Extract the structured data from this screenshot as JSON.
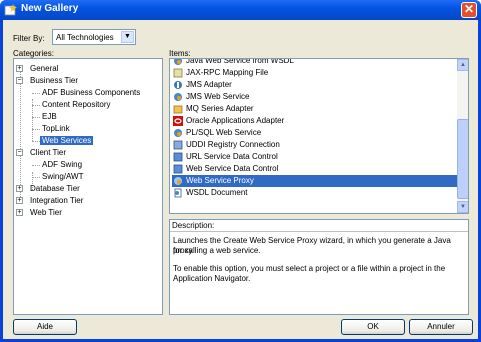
{
  "window": {
    "title": "New Gallery",
    "close_glyph": "✕"
  },
  "filter": {
    "label": "Filter By:",
    "value": "All Technologies"
  },
  "categories": {
    "label": "Categories:",
    "nodes": [
      {
        "label": "General",
        "expander": "+"
      },
      {
        "label": "Business Tier",
        "expander": "−"
      },
      {
        "label": "ADF Business Components"
      },
      {
        "label": "Content Repository"
      },
      {
        "label": "EJB"
      },
      {
        "label": "TopLink"
      },
      {
        "label": "Web Services",
        "selected": true
      },
      {
        "label": "Client Tier",
        "expander": "−"
      },
      {
        "label": "ADF Swing"
      },
      {
        "label": "Swing/AWT"
      },
      {
        "label": "Database Tier",
        "expander": "+"
      },
      {
        "label": "Integration Tier",
        "expander": "+"
      },
      {
        "label": "Web Tier",
        "expander": "+"
      }
    ]
  },
  "items": {
    "label": "Items:",
    "rows": [
      {
        "label": "Java Web Service from WSDL",
        "icon": "java-web-service-icon"
      },
      {
        "label": "JAX-RPC Mapping File",
        "icon": "xml-file-icon"
      },
      {
        "label": "JMS Adapter",
        "icon": "adapter-icon"
      },
      {
        "label": "JMS Web Service",
        "icon": "web-service-icon"
      },
      {
        "label": "MQ Series Adapter",
        "icon": "mq-adapter-icon"
      },
      {
        "label": "Oracle Applications Adapter",
        "icon": "oracle-icon"
      },
      {
        "label": "PL/SQL Web Service",
        "icon": "web-service-icon"
      },
      {
        "label": "UDDI Registry Connection",
        "icon": "connection-icon"
      },
      {
        "label": "URL Service Data Control",
        "icon": "data-control-icon"
      },
      {
        "label": "Web Service Data Control",
        "icon": "data-control-icon"
      },
      {
        "label": "Web Service Proxy",
        "icon": "proxy-icon",
        "selected": true
      },
      {
        "label": "WSDL Document",
        "icon": "wsdl-document-icon"
      }
    ],
    "scroll_up_glyph": "▲",
    "scroll_down_glyph": "▼"
  },
  "description": {
    "label": "Description:",
    "line1": "Launches the Create Web Service Proxy wizard, in which you generate a Java proxy",
    "line2": "for calling a web service.",
    "line3": "To enable this option, you must select a project or a file within a project in the",
    "line4": "Application Navigator."
  },
  "buttons": {
    "help": "Aide",
    "ok": "OK",
    "cancel": "Annuler"
  },
  "colors": {
    "titlebar": "#0554e3",
    "selection": "#316ac5",
    "dialog": "#ece9d8",
    "close": "#e2512d"
  }
}
